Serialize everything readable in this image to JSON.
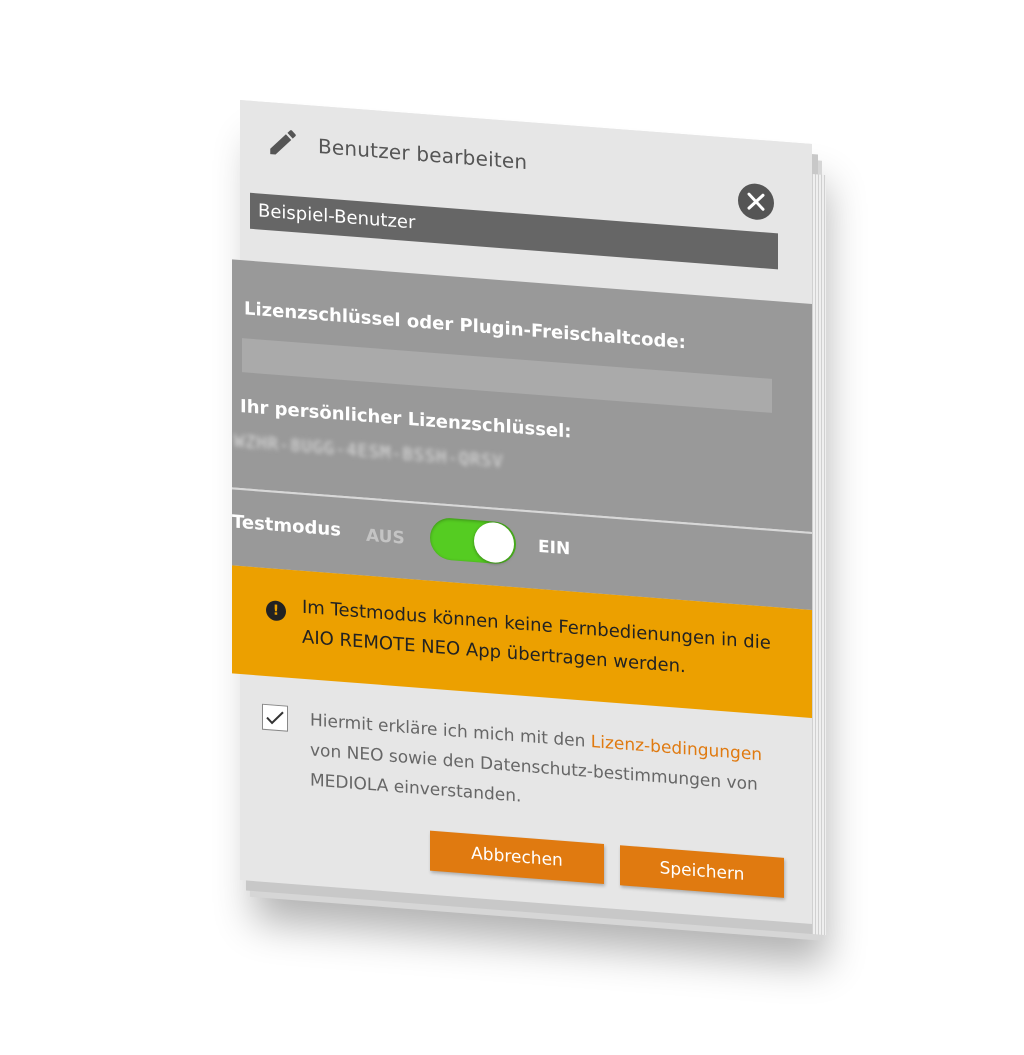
{
  "dialog": {
    "title": "Benutzer bearbeiten",
    "icons": {
      "edit": "pencil-icon",
      "close": "close-icon",
      "warning": "exclamation-icon",
      "checkbox": "checkmark-icon"
    }
  },
  "username": {
    "value": "Beispiel-Benutzer"
  },
  "license": {
    "label": "Lizenzschlüssel oder Plugin-Freischaltcode:",
    "value": "",
    "personal_label": "Ihr persönlicher Lizenzschlüssel:",
    "personal_key": "WZHR-8UGG-4ESM-BSSH-QRSV"
  },
  "test_mode": {
    "label": "Testmodus",
    "off_label": "AUS",
    "on_label": "EIN",
    "enabled": true
  },
  "warning": {
    "text": "Im Testmodus können keine Fernbedienungen in die AIO REMOTE NEO App übertragen werden."
  },
  "consent": {
    "checked": true,
    "text_before": "Hiermit erkläre ich mich mit den ",
    "link_text": "Lizenz-bedingungen",
    "text_after": " von NEO sowie den Datenschutz-bestimmungen von MEDIOLA einverstanden."
  },
  "buttons": {
    "cancel_label": "Abbrechen",
    "save_label": "Speichern"
  },
  "colors": {
    "accent": "#e07a10",
    "warning_bg": "#eca000",
    "toggle_on": "#55cc22",
    "panel_gray": "#999999",
    "header_bg": "#e6e6e6"
  }
}
